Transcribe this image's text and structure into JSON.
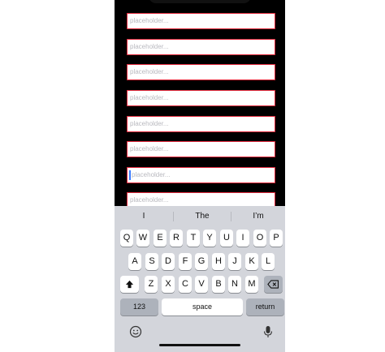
{
  "fields": [
    {
      "placeholder": "placeholder...",
      "focused": false
    },
    {
      "placeholder": "placeholder...",
      "focused": false
    },
    {
      "placeholder": "placeholder...",
      "focused": false
    },
    {
      "placeholder": "placeholder...",
      "focused": false
    },
    {
      "placeholder": "placeholder...",
      "focused": false
    },
    {
      "placeholder": "placeholder...",
      "focused": false
    },
    {
      "placeholder": "placeholder...",
      "focused": true
    },
    {
      "placeholder": "placeholder...",
      "focused": false
    }
  ],
  "keyboard": {
    "suggestions": [
      "I",
      "The",
      "I’m"
    ],
    "row1": [
      "Q",
      "W",
      "E",
      "R",
      "T",
      "Y",
      "U",
      "I",
      "O",
      "P"
    ],
    "row2": [
      "A",
      "S",
      "D",
      "F",
      "G",
      "H",
      "J",
      "K",
      "L"
    ],
    "row3": [
      "Z",
      "X",
      "C",
      "V",
      "B",
      "N",
      "M"
    ],
    "numbers_label": "123",
    "space_label": "space",
    "return_label": "return",
    "shift_icon": "shift-arrow-icon",
    "delete_icon": "delete-backspace-icon",
    "emoji_icon": "emoji-icon",
    "mic_icon": "microphone-icon"
  },
  "colors": {
    "field_border": "#e0283b",
    "caret": "#3b7bff",
    "keyboard_bg": "#d3d5db"
  }
}
